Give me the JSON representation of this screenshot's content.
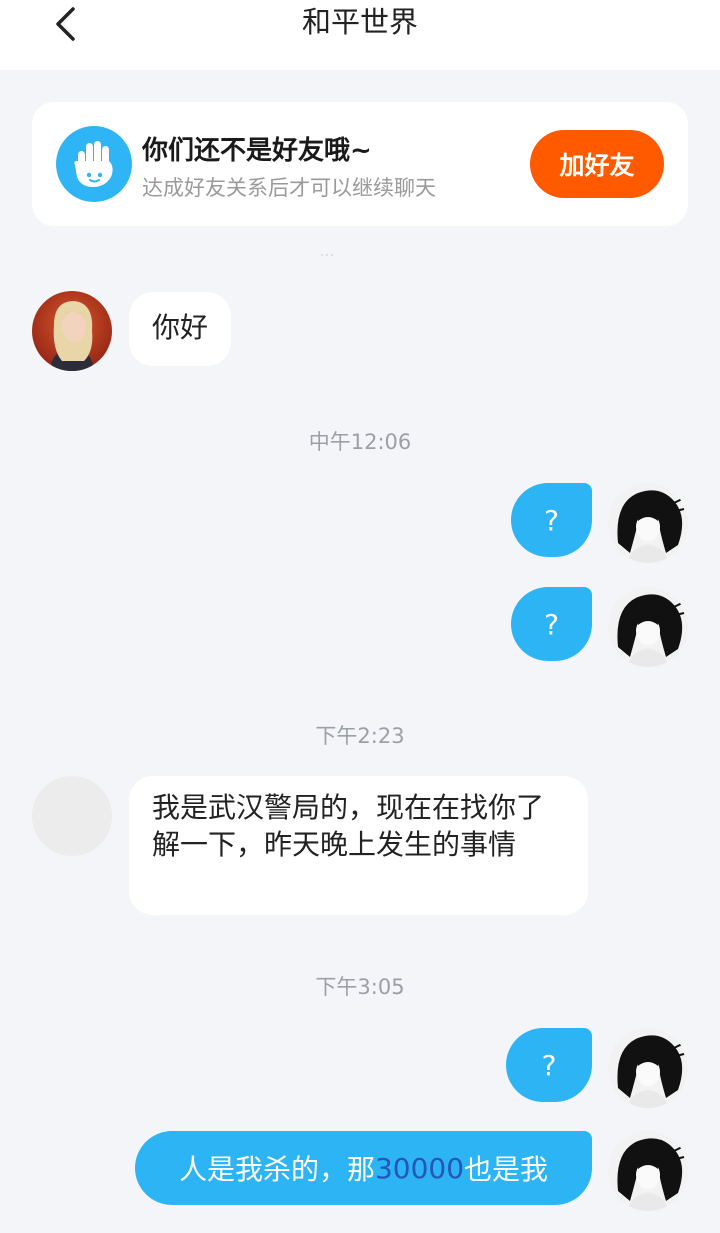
{
  "header": {
    "title": "和平世界"
  },
  "friend_prompt": {
    "title": "你们还不是好友哦~",
    "subtitle": "达成好友关系后才可以继续聊天",
    "button_label": "加好友"
  },
  "messages": [
    {
      "side": "left",
      "text": "你好"
    },
    {
      "timestamp": "中午12:06"
    },
    {
      "side": "right",
      "text": "?"
    },
    {
      "side": "right",
      "text": "?"
    },
    {
      "timestamp": "下午2:23"
    },
    {
      "side": "left",
      "text": "我是武汉警局的，现在在找你了解一下，昨天晚上发生的事情"
    },
    {
      "timestamp": "下午3:05"
    },
    {
      "side": "right",
      "text": "?"
    },
    {
      "side": "right",
      "text_before": "人是我杀的，那",
      "text_highlight": "30000",
      "text_after": "也是我"
    }
  ],
  "colors": {
    "accent_blue": "#2cb4f5",
    "add_button": "#ff5a00",
    "background": "#f3f5f8"
  }
}
